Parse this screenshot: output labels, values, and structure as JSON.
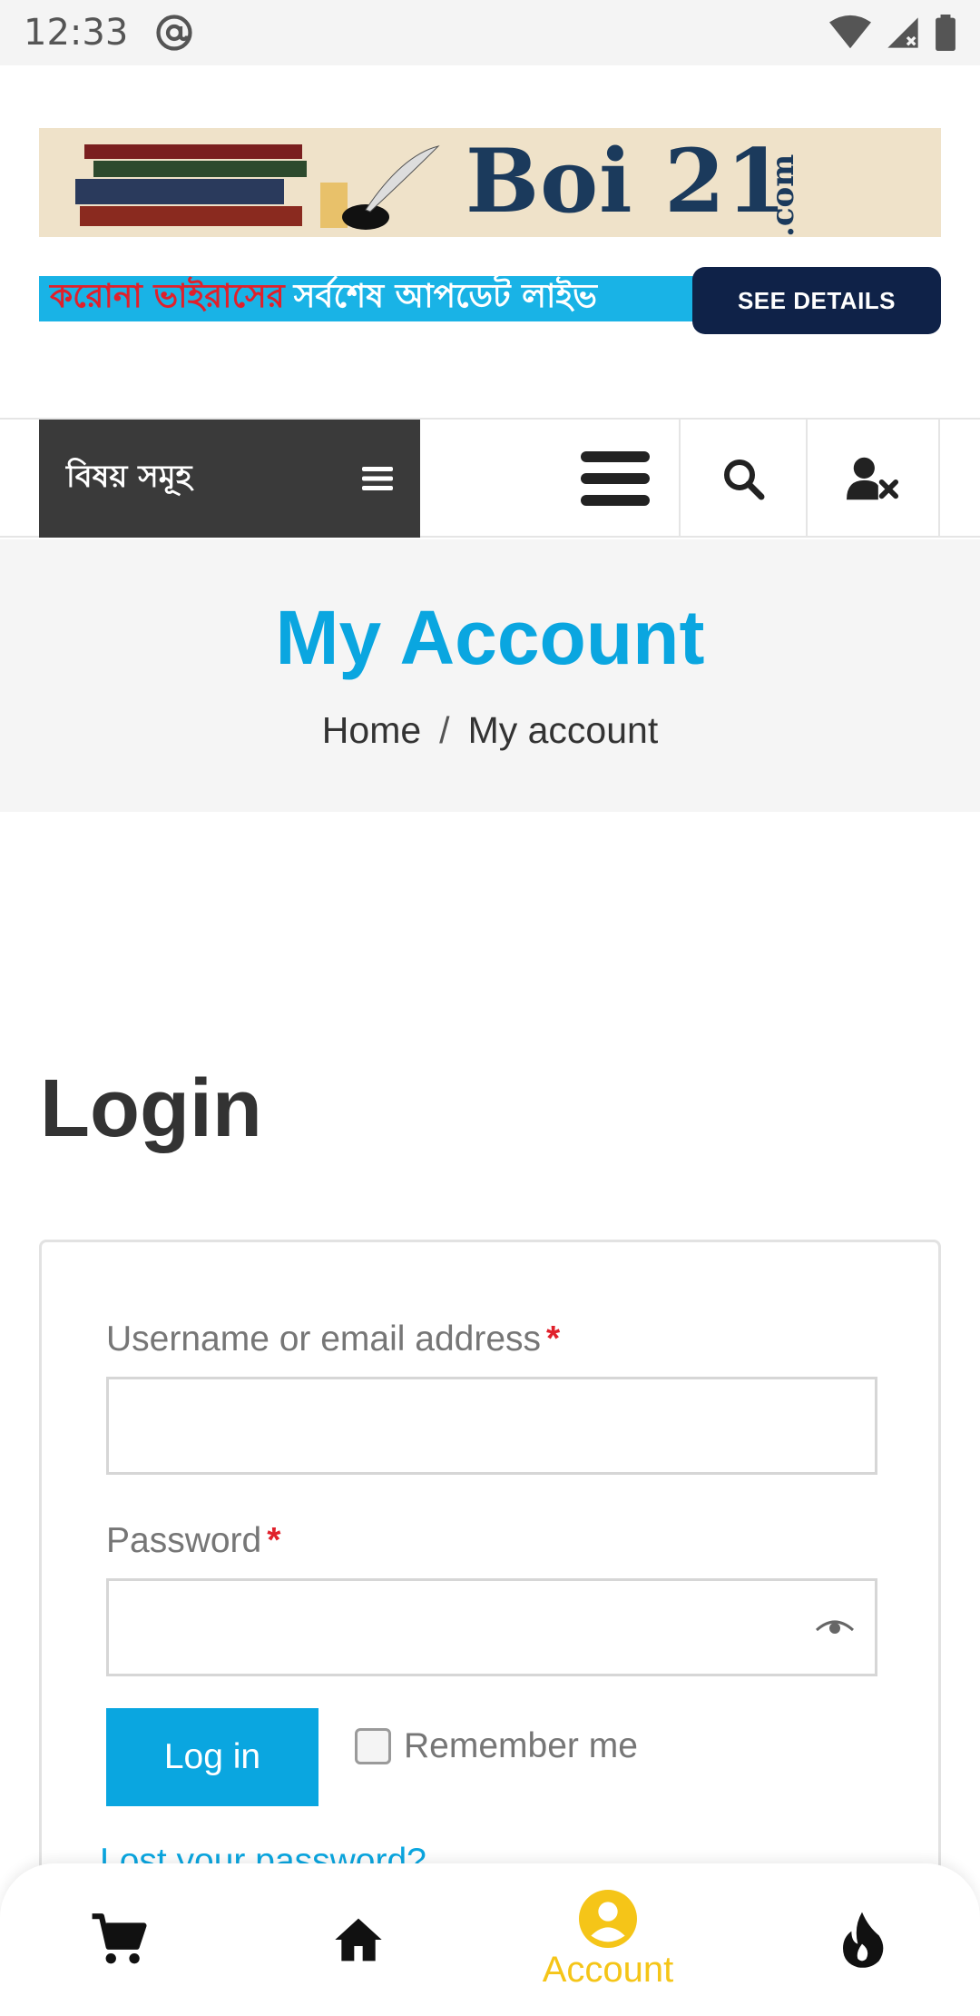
{
  "status_bar": {
    "time": "12:33"
  },
  "header": {
    "logo_text": "Boi 21",
    "logo_suffix": ".com",
    "covid_red": "করোনা ভাইরাসের",
    "covid_white": "সর্বশেষ আপডেট লাইভ",
    "see_details": "SEE DETAILS"
  },
  "nav": {
    "categories_label": "বিষয় সমূহ"
  },
  "page": {
    "title": "My Account",
    "breadcrumb": {
      "home": "Home",
      "separator": "/",
      "current": "My account"
    }
  },
  "login": {
    "heading": "Login",
    "username_label": "Username or email address",
    "password_label": "Password",
    "required_mark": "*",
    "login_button": "Log in",
    "remember_me": "Remember me",
    "lost_password": "Lost your password?"
  },
  "bottom_nav": {
    "account_label": "Account"
  },
  "colors": {
    "accent": "#0aa6e0",
    "active_tab": "#f5c518",
    "required": "#e0202b",
    "nav_dark": "#3a3a3a"
  }
}
